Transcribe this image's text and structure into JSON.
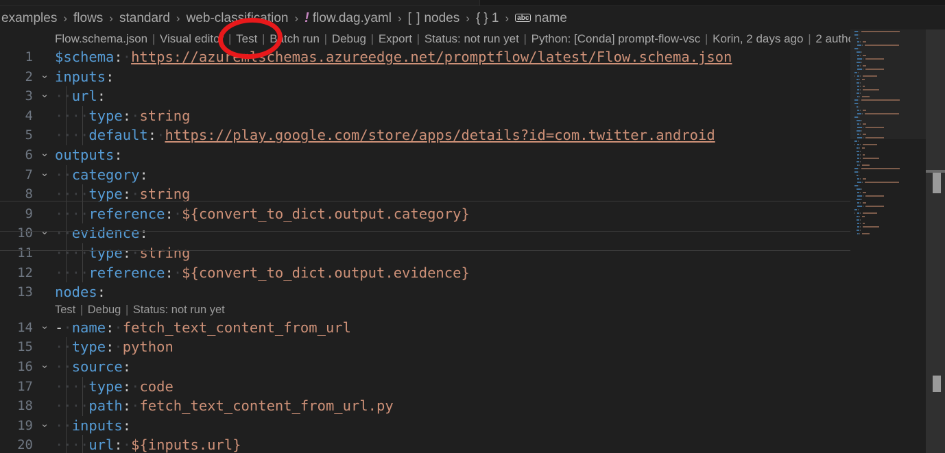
{
  "breadcrumb": {
    "separator": "›",
    "items": [
      {
        "label": "examples",
        "icon": ""
      },
      {
        "label": "flows",
        "icon": ""
      },
      {
        "label": "standard",
        "icon": ""
      },
      {
        "label": "web-classification",
        "icon": ""
      },
      {
        "label": "flow.dag.yaml",
        "icon": "yaml-file-icon",
        "glyph": "!"
      },
      {
        "label": "nodes",
        "icon": "array-symbol-icon",
        "glyph": "[ ]"
      },
      {
        "label": "1",
        "icon": "object-symbol-icon",
        "glyph": "{ }"
      },
      {
        "label": "name",
        "icon": "string-symbol-icon",
        "glyph": "abc"
      }
    ]
  },
  "codelens_top": {
    "items": [
      "Flow.schema.json",
      "Visual editor",
      "Test",
      "Batch run",
      "Debug",
      "Export",
      "Status: not run yet",
      "Python: [Conda] prompt-flow-vsc",
      "Korin, 2 days ago",
      "2 autho"
    ],
    "separator": "|"
  },
  "codelens_node": {
    "items": [
      "Test",
      "Debug",
      "Status: not run yet"
    ],
    "separator": "|"
  },
  "editor": {
    "language": "yaml",
    "file": "flow.dag.yaml",
    "lines": [
      {
        "num": "1",
        "fold": "",
        "tokens": [
          {
            "t": "$schema",
            "c": "k"
          },
          {
            "t": ":",
            "c": "p"
          },
          {
            "t": "·",
            "c": "ws"
          },
          {
            "t": "https://azuremlschemas.azureedge.net/promptflow/latest/Flow.schema.json",
            "c": "lnk"
          }
        ]
      },
      {
        "num": "2",
        "fold": "chevron-down",
        "tokens": [
          {
            "t": "inputs",
            "c": "k"
          },
          {
            "t": ":",
            "c": "p"
          }
        ]
      },
      {
        "num": "3",
        "fold": "chevron-down",
        "tokens": [
          {
            "t": "··",
            "c": "ws"
          },
          {
            "t": "url",
            "c": "k"
          },
          {
            "t": ":",
            "c": "p"
          }
        ]
      },
      {
        "num": "4",
        "fold": "",
        "tokens": [
          {
            "t": "····",
            "c": "ws"
          },
          {
            "t": "type",
            "c": "k"
          },
          {
            "t": ":",
            "c": "p"
          },
          {
            "t": "·",
            "c": "ws"
          },
          {
            "t": "string",
            "c": "s"
          }
        ]
      },
      {
        "num": "5",
        "fold": "",
        "tokens": [
          {
            "t": "····",
            "c": "ws"
          },
          {
            "t": "default",
            "c": "k"
          },
          {
            "t": ":",
            "c": "p"
          },
          {
            "t": "·",
            "c": "ws"
          },
          {
            "t": "https://play.google.com/store/apps/details?id=com.twitter.android",
            "c": "lnk"
          }
        ]
      },
      {
        "num": "6",
        "fold": "chevron-down",
        "tokens": [
          {
            "t": "outputs",
            "c": "k"
          },
          {
            "t": ":",
            "c": "p"
          }
        ]
      },
      {
        "num": "7",
        "fold": "chevron-down",
        "tokens": [
          {
            "t": "··",
            "c": "ws"
          },
          {
            "t": "category",
            "c": "k"
          },
          {
            "t": ":",
            "c": "p"
          }
        ]
      },
      {
        "num": "8",
        "fold": "",
        "tokens": [
          {
            "t": "····",
            "c": "ws"
          },
          {
            "t": "type",
            "c": "k"
          },
          {
            "t": ":",
            "c": "p"
          },
          {
            "t": "·",
            "c": "ws"
          },
          {
            "t": "string",
            "c": "s"
          }
        ]
      },
      {
        "num": "9",
        "fold": "",
        "tokens": [
          {
            "t": "····",
            "c": "ws"
          },
          {
            "t": "reference",
            "c": "k"
          },
          {
            "t": ":",
            "c": "p"
          },
          {
            "t": "·",
            "c": "ws"
          },
          {
            "t": "${convert_to_dict.output.category}",
            "c": "s"
          }
        ]
      },
      {
        "num": "10",
        "fold": "chevron-down",
        "tokens": [
          {
            "t": "··",
            "c": "ws"
          },
          {
            "t": "evidence",
            "c": "k"
          },
          {
            "t": ":",
            "c": "p"
          }
        ]
      },
      {
        "num": "11",
        "fold": "",
        "tokens": [
          {
            "t": "····",
            "c": "ws"
          },
          {
            "t": "type",
            "c": "k"
          },
          {
            "t": ":",
            "c": "p"
          },
          {
            "t": "·",
            "c": "ws"
          },
          {
            "t": "string",
            "c": "s"
          }
        ]
      },
      {
        "num": "12",
        "fold": "",
        "tokens": [
          {
            "t": "····",
            "c": "ws"
          },
          {
            "t": "reference",
            "c": "k"
          },
          {
            "t": ":",
            "c": "p"
          },
          {
            "t": "·",
            "c": "ws"
          },
          {
            "t": "${convert_to_dict.output.evidence}",
            "c": "s"
          }
        ]
      },
      {
        "num": "13",
        "fold": "",
        "tokens": [
          {
            "t": "nodes",
            "c": "k"
          },
          {
            "t": ":",
            "c": "p"
          }
        ]
      },
      {
        "num": "14",
        "fold": "chevron-down",
        "tokens": [
          {
            "t": "-",
            "c": "p"
          },
          {
            "t": "·",
            "c": "ws"
          },
          {
            "t": "name",
            "c": "k"
          },
          {
            "t": ":",
            "c": "p"
          },
          {
            "t": "·",
            "c": "ws"
          },
          {
            "t": "fetch_text_content_from_url",
            "c": "s"
          }
        ]
      },
      {
        "num": "15",
        "fold": "",
        "tokens": [
          {
            "t": "··",
            "c": "ws"
          },
          {
            "t": "type",
            "c": "k"
          },
          {
            "t": ":",
            "c": "p"
          },
          {
            "t": "·",
            "c": "ws"
          },
          {
            "t": "python",
            "c": "s"
          }
        ]
      },
      {
        "num": "16",
        "fold": "chevron-down",
        "tokens": [
          {
            "t": "··",
            "c": "ws"
          },
          {
            "t": "source",
            "c": "k"
          },
          {
            "t": ":",
            "c": "p"
          }
        ]
      },
      {
        "num": "17",
        "fold": "",
        "tokens": [
          {
            "t": "····",
            "c": "ws"
          },
          {
            "t": "type",
            "c": "k"
          },
          {
            "t": ":",
            "c": "p"
          },
          {
            "t": "·",
            "c": "ws"
          },
          {
            "t": "code",
            "c": "s"
          }
        ]
      },
      {
        "num": "18",
        "fold": "",
        "tokens": [
          {
            "t": "····",
            "c": "ws"
          },
          {
            "t": "path",
            "c": "k"
          },
          {
            "t": ":",
            "c": "p"
          },
          {
            "t": "·",
            "c": "ws"
          },
          {
            "t": "fetch_text_content_from_url.py",
            "c": "s"
          }
        ]
      },
      {
        "num": "19",
        "fold": "chevron-down",
        "tokens": [
          {
            "t": "··",
            "c": "ws"
          },
          {
            "t": "inputs",
            "c": "k"
          },
          {
            "t": ":",
            "c": "p"
          }
        ]
      },
      {
        "num": "20",
        "fold": "",
        "tokens": [
          {
            "t": "····",
            "c": "ws"
          },
          {
            "t": "url",
            "c": "k"
          },
          {
            "t": ":",
            "c": "p"
          },
          {
            "t": "·",
            "c": "ws"
          },
          {
            "t": "${inputs.url}",
            "c": "s"
          }
        ]
      }
    ]
  },
  "colors": {
    "background": "#1f1f1f",
    "key": "#569cd6",
    "string": "#ce9178",
    "line_number": "#6e7681",
    "codelens": "#9a9a9a",
    "annotation": "#e8191b",
    "yaml_icon": "#c586c0",
    "scrollbar": "#303030"
  },
  "annotation": {
    "shape": "ellipse",
    "target": "Test",
    "color": "#e8191b"
  }
}
